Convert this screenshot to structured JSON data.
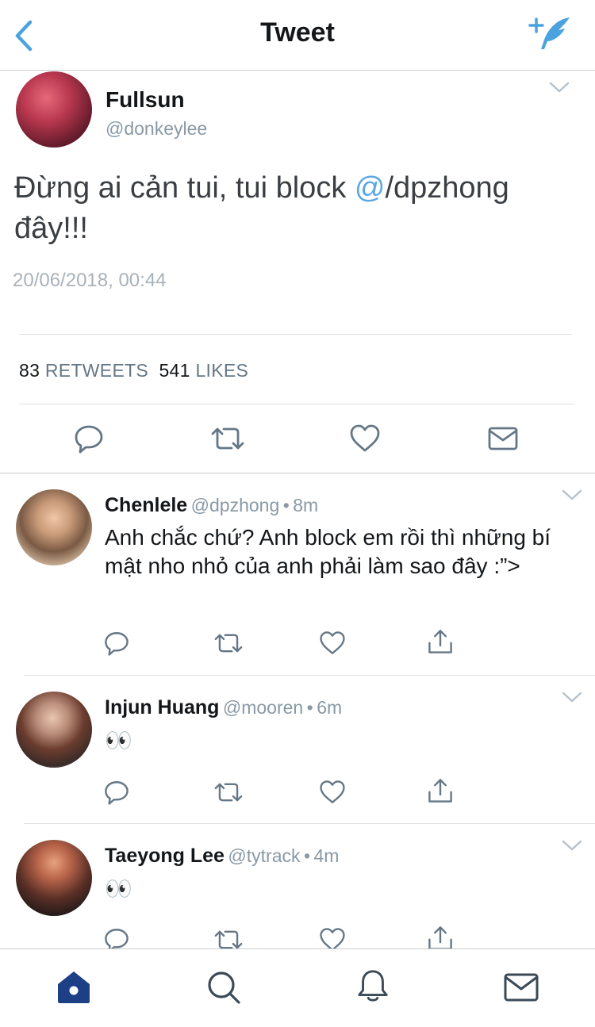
{
  "header": {
    "title": "Tweet",
    "back_icon": "back-chevron-icon",
    "compose_icon": "compose-tweet-icon",
    "accent": "#4aa3df"
  },
  "tweet": {
    "name": "Fullsun",
    "handle": "@donkeylee",
    "text_before": "Đừng ai cản tui, tui block ",
    "mention": "@",
    "text_after": "/dpzhong đây!!!",
    "timestamp": "20/06/2018, 00:44",
    "retweets_count": "83",
    "retweets_label": "RETWEETS",
    "likes_count": "541",
    "likes_label": "LIKES"
  },
  "replies": [
    {
      "name": "Chenlele",
      "handle": "@dpzhong",
      "time": "8m",
      "text": "Anh chắc chứ? Anh block em rồi thì những bí mật nho nhỏ của anh phải làm sao đây :”>"
    },
    {
      "name": "Injun Huang",
      "handle": "@mooren",
      "time": "6m",
      "text": "👀"
    },
    {
      "name": "Taeyong Lee",
      "handle": "@tytrack",
      "time": "4m",
      "text": "👀"
    }
  ],
  "tabbar": {
    "items": [
      "home-icon",
      "search-icon",
      "notifications-icon",
      "messages-icon"
    ],
    "active_color": "#1d3f86"
  }
}
